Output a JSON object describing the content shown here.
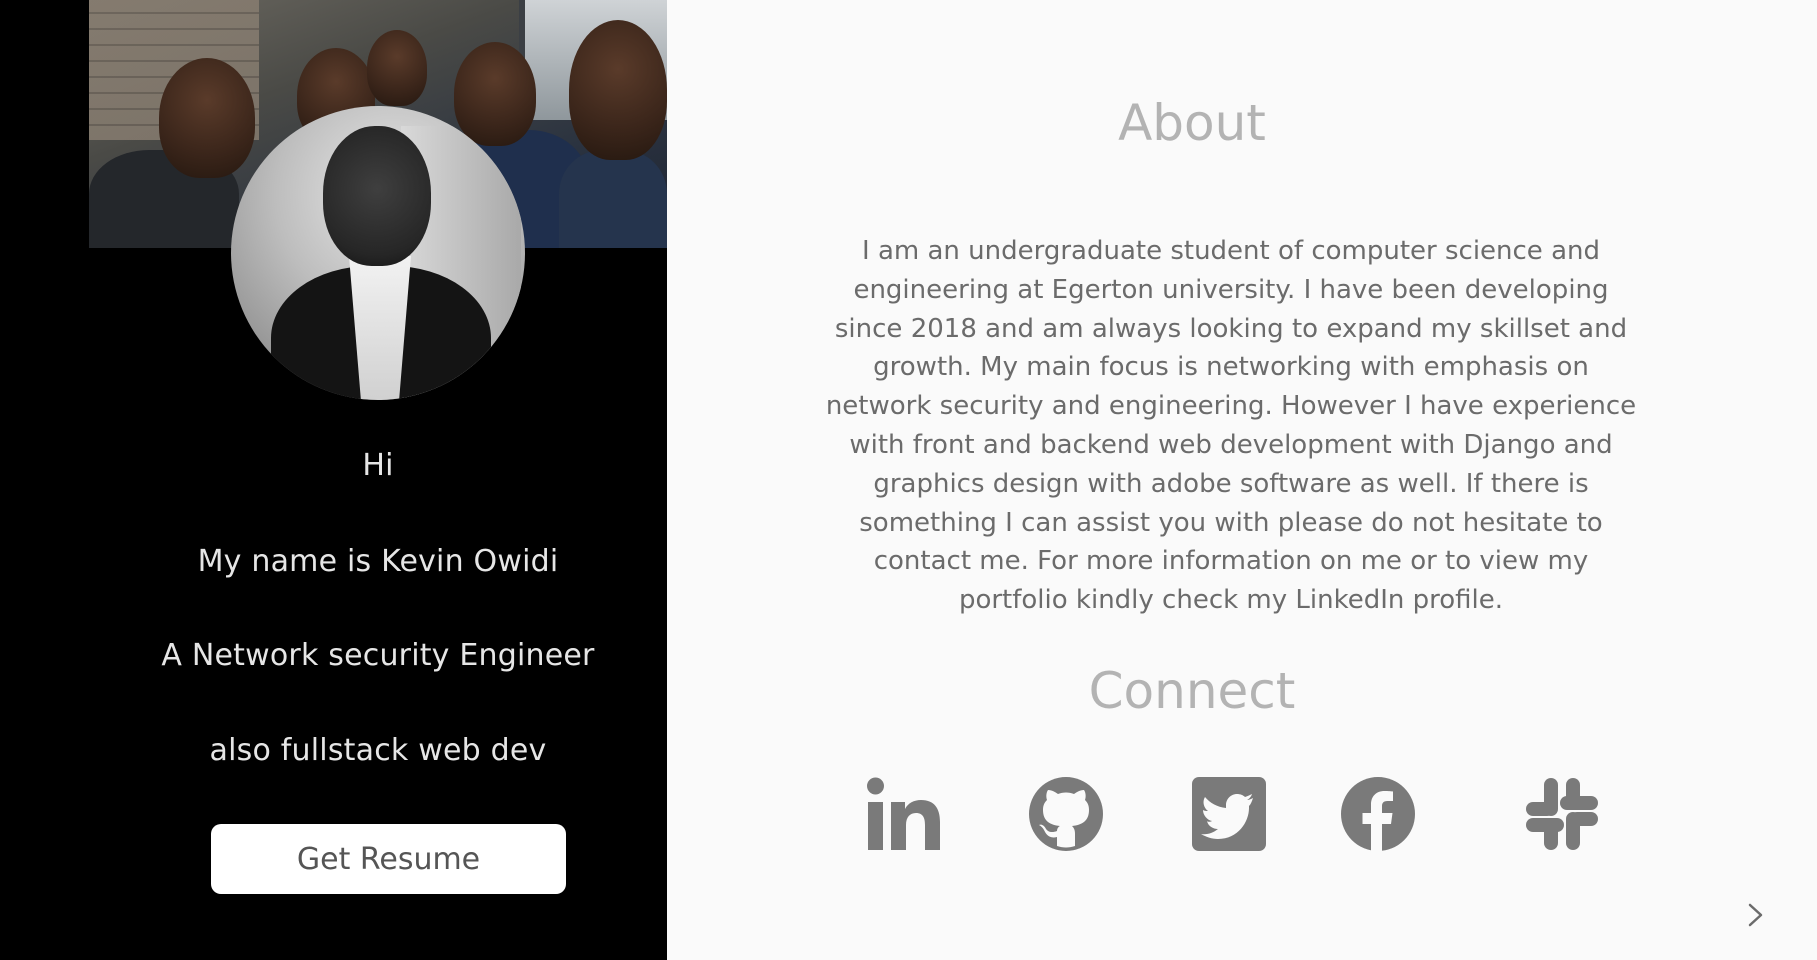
{
  "profile": {
    "greeting": "Hi",
    "name_line": "My name is Kevin Owidi",
    "role_line": "A Network security Engineer",
    "extra_line": "also fullstack web dev",
    "resume_button_label": "Get Resume"
  },
  "about": {
    "title": "About",
    "text": "I am an undergraduate student of computer science and engineering at Egerton university. I have been developing since 2018 and am always looking to expand my skillset and growth. My main focus is networking with emphasis on network security and engineering. However I have experience with front and backend web development with Django and graphics design with adobe software as well. If there is something I can assist you with please do not hesitate to contact me. For more information on me or to view my portfolio kindly check my LinkedIn profile."
  },
  "connect": {
    "title": "Connect",
    "links": [
      {
        "icon": "linkedin-icon"
      },
      {
        "icon": "github-icon"
      },
      {
        "icon": "twitter-icon"
      },
      {
        "icon": "facebook-icon"
      },
      {
        "icon": "slack-icon"
      }
    ]
  },
  "colors": {
    "left_panel_bg": "#000000",
    "page_bg": "#fafafa",
    "heading": "#b3b3b3",
    "body_text": "#6b6b6b",
    "icon": "#7a7a7a"
  }
}
